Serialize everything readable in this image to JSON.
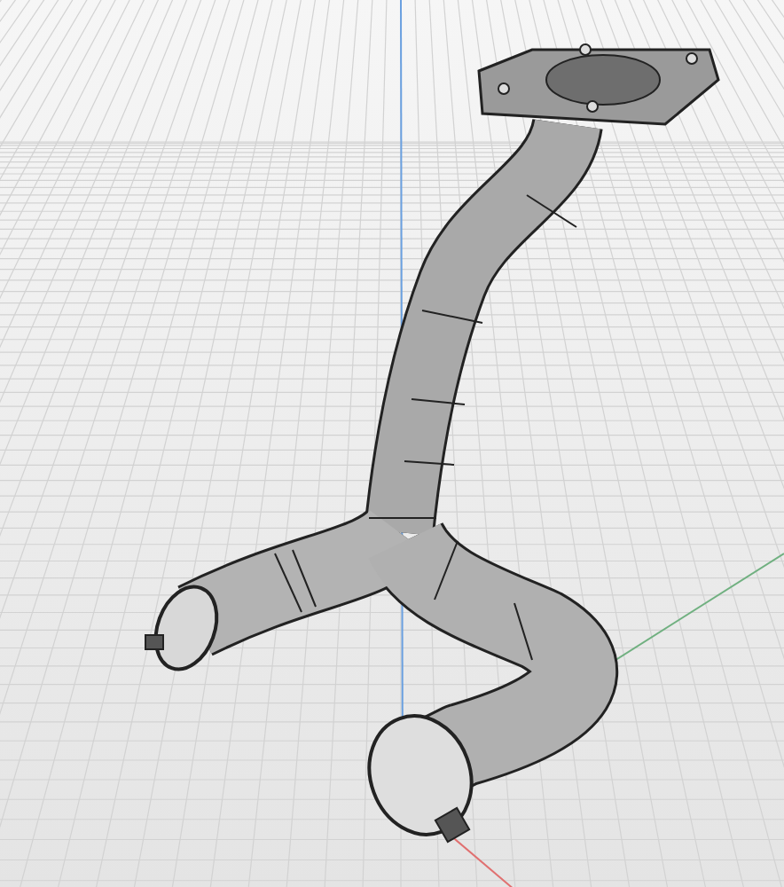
{
  "viewport": {
    "axes": [
      {
        "kind": "vertical",
        "color": "#6aa0e0"
      },
      {
        "kind": "right",
        "color": "#e07070"
      },
      {
        "kind": "depth",
        "color": "#70b080"
      }
    ]
  }
}
